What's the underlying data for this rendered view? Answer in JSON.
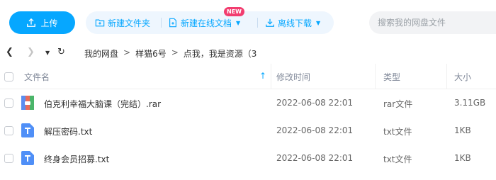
{
  "toolbar": {
    "upload_label": "上传",
    "new_folder_label": "新建文件夹",
    "new_online_doc_label": "新建在线文档",
    "new_badge": "NEW",
    "offline_download_label": "离线下载",
    "search_placeholder": "搜索我的网盘文件"
  },
  "breadcrumb": [
    "我的网盘",
    "样猫6号",
    "点我，我是资源（3"
  ],
  "table": {
    "headers": {
      "name": "文件名",
      "modified": "修改时间",
      "type": "类型",
      "size": "大小"
    },
    "sort_column": "name",
    "rows": [
      {
        "icon": "rar-archive-icon",
        "name": "伯克利幸福大脑课（完结）.rar",
        "modified": "2022-06-08 22:01",
        "type": "rar文件",
        "size": "3.11GB"
      },
      {
        "icon": "txt-file-icon",
        "name": "解压密码.txt",
        "modified": "2022-06-08 22:01",
        "type": "txt文件",
        "size": "1KB"
      },
      {
        "icon": "txt-file-icon",
        "name": "终身会员招募.txt",
        "modified": "2022-06-08 22:01",
        "type": "txt文件",
        "size": "1KB"
      }
    ]
  },
  "colors": {
    "accent": "#06a7ff",
    "action_bar_bg": "#eef6fe",
    "new_badge": "#f23d6f",
    "search_bg": "#f2f3f5"
  }
}
